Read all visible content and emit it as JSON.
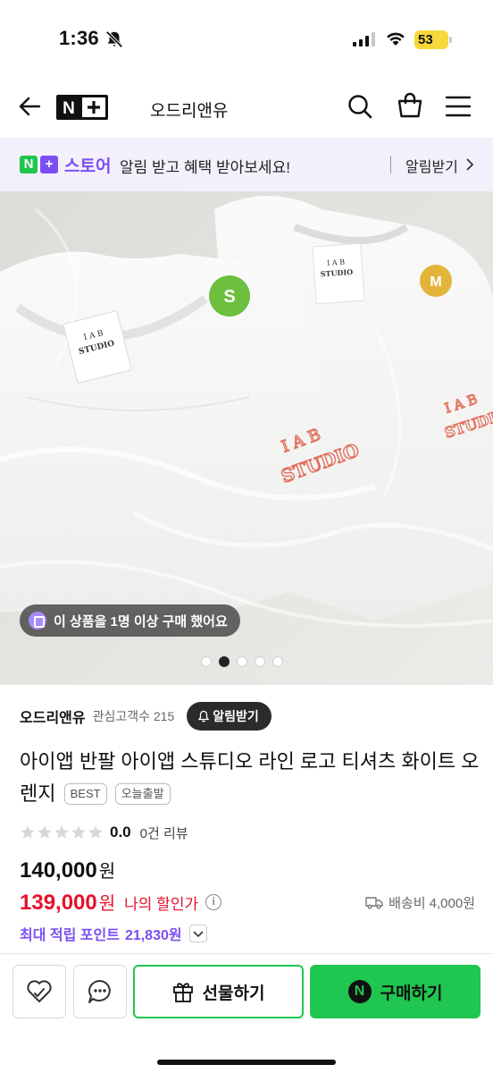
{
  "status_bar": {
    "time": "1:36",
    "battery": "53"
  },
  "nav": {
    "logo_text": "N+",
    "store_name": "오드리앤유"
  },
  "banner": {
    "brand": "스토어",
    "message": "알림 받고 혜택 받아보세요!",
    "action": "알림받기"
  },
  "image": {
    "shirt_left": {
      "brand_line1": "I A B",
      "brand_line2": "STUDIO",
      "size": "S"
    },
    "shirt_right": {
      "brand_line1": "I A B",
      "brand_line2": "STUDIO",
      "size": "M"
    },
    "buyer_pill": "이 상품을 1명 이상 구매 했어요",
    "total_images": 5,
    "active_image": 2
  },
  "store": {
    "name": "오드리앤유",
    "fav_label": "관심고객수 215",
    "alarm_button": "알림받기"
  },
  "product": {
    "title": "아이앱 반팔 아이앱 스튜디오 라인 로고 티셔츠 화이트 오렌지",
    "tags": [
      "BEST",
      "오늘출발"
    ]
  },
  "rating": {
    "stars_filled": 0,
    "value": "0.0",
    "reviews": "0건 리뷰"
  },
  "price": {
    "original": "140,000",
    "sale": "139,000",
    "currency": "원",
    "discount_label": "나의 할인가",
    "shipping": "배송비 4,000원"
  },
  "points": {
    "label": "최대 적립 포인트",
    "value": "21,830원"
  },
  "bottom": {
    "gift": "선물하기",
    "buy": "구매하기",
    "npay": "N"
  },
  "colors": {
    "green": "#1fc64f",
    "purple": "#7b4ff2",
    "red": "#e5122b"
  }
}
